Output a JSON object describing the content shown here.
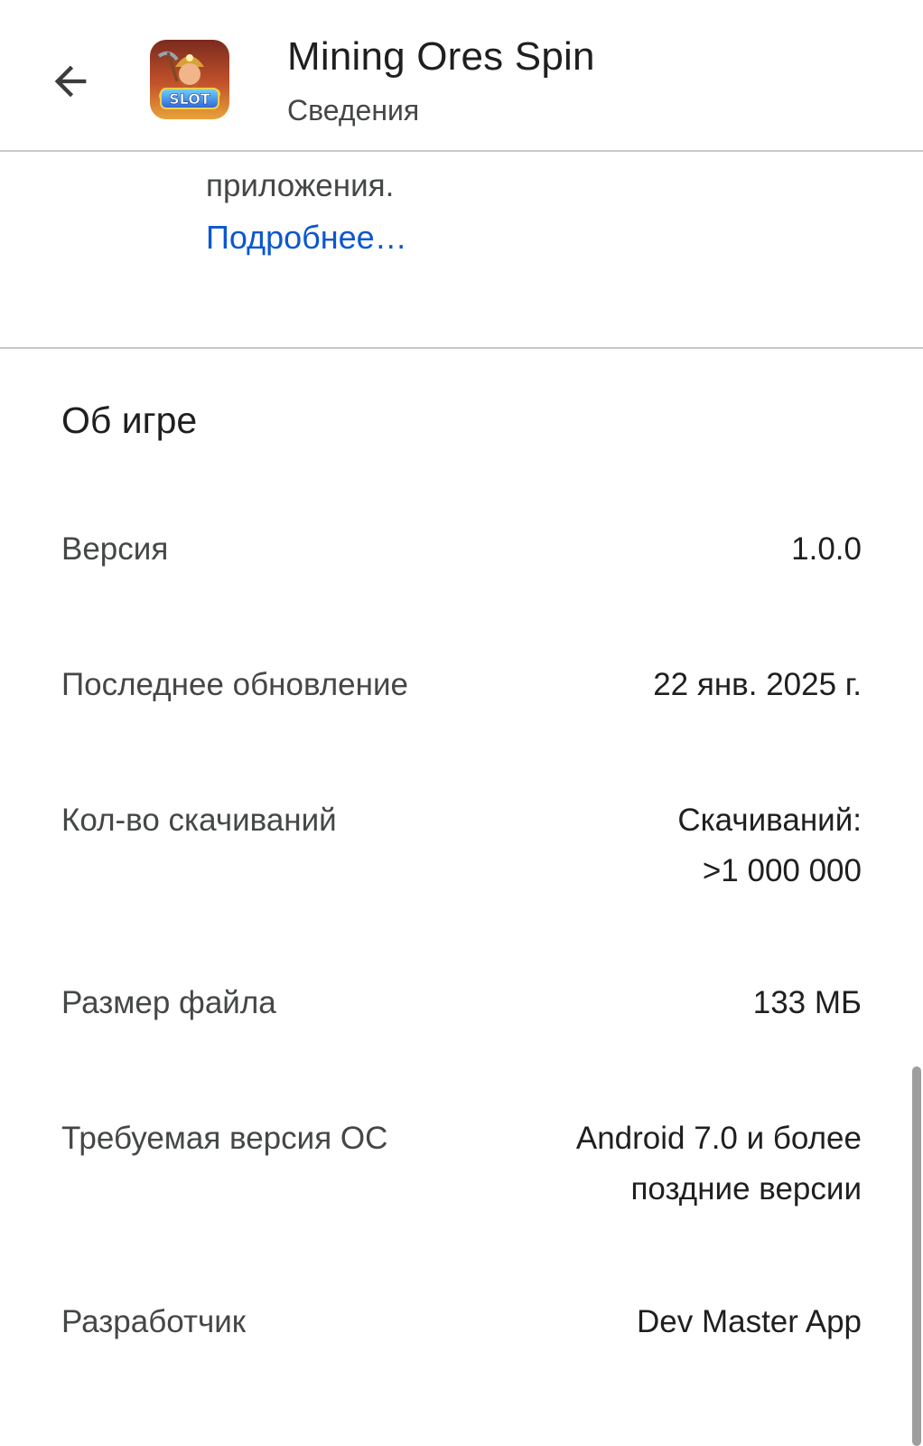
{
  "header": {
    "title": "Mining Ores Spin",
    "subtitle": "Сведения",
    "back_icon": "arrow-back-icon",
    "app_icon_text": "SLOT"
  },
  "description": {
    "cut_text": "приложения.",
    "more_link": "Подробнее…"
  },
  "about": {
    "title": "Об игре",
    "rows": [
      {
        "label": "Версия",
        "value_lines": [
          "1.0.0"
        ]
      },
      {
        "label": "Последнее обновление",
        "value_lines": [
          "22 янв. 2025 г."
        ]
      },
      {
        "label": "Кол-во скачиваний",
        "value_lines": [
          "Скачиваний:",
          ">1 000 000"
        ]
      },
      {
        "label": "Размер файла",
        "value_lines": [
          "133 МБ"
        ]
      },
      {
        "label": "Требуемая версия ОС",
        "value_lines": [
          "Android 7.0 и более",
          "поздние версии"
        ]
      },
      {
        "label": "Разработчик",
        "value_lines": [
          "Dev Master App"
        ]
      }
    ]
  },
  "colors": {
    "link": "#0b57d0",
    "primary_text": "#1f1f1f",
    "secondary_text": "#444746",
    "divider": "#c8c8c8"
  }
}
